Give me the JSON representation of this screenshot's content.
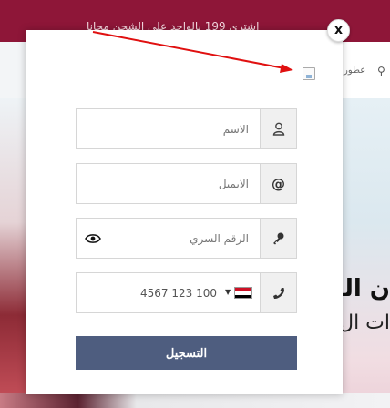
{
  "topbar": {
    "promo_text": "اشترى 199 بالواحد على الشحن مجانا"
  },
  "nav": {
    "item_label": "عطور"
  },
  "hero": {
    "title_fragment": "ن المستـ",
    "subtitle_fragment": "ات ال"
  },
  "modal": {
    "close_label": "x",
    "fields": {
      "name_placeholder": "الاسم",
      "email_placeholder": "الايميل",
      "password_placeholder": "الرقم السري",
      "phone_value": "4567 123 100"
    },
    "submit_label": "التسجيل"
  },
  "colors": {
    "topbar": "#8e1638",
    "submit": "#4e5d7f",
    "annotation_arrow": "#e01010"
  }
}
